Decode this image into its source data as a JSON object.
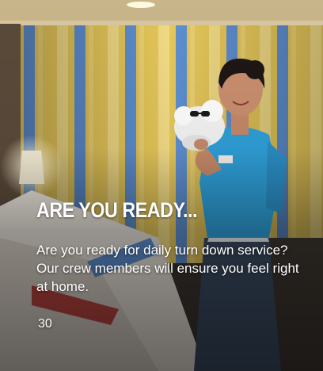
{
  "card": {
    "title": "ARE YOU READY...",
    "description": "Are you ready for daily turn down service? Our crew members will ensure you feel right at home.",
    "page_number": "30"
  },
  "colors": {
    "curtain_yellow": "#e6c454",
    "curtain_blue": "#5f8fd0",
    "uniform_blue": "#2f9fd8",
    "text": "#ffffff"
  }
}
